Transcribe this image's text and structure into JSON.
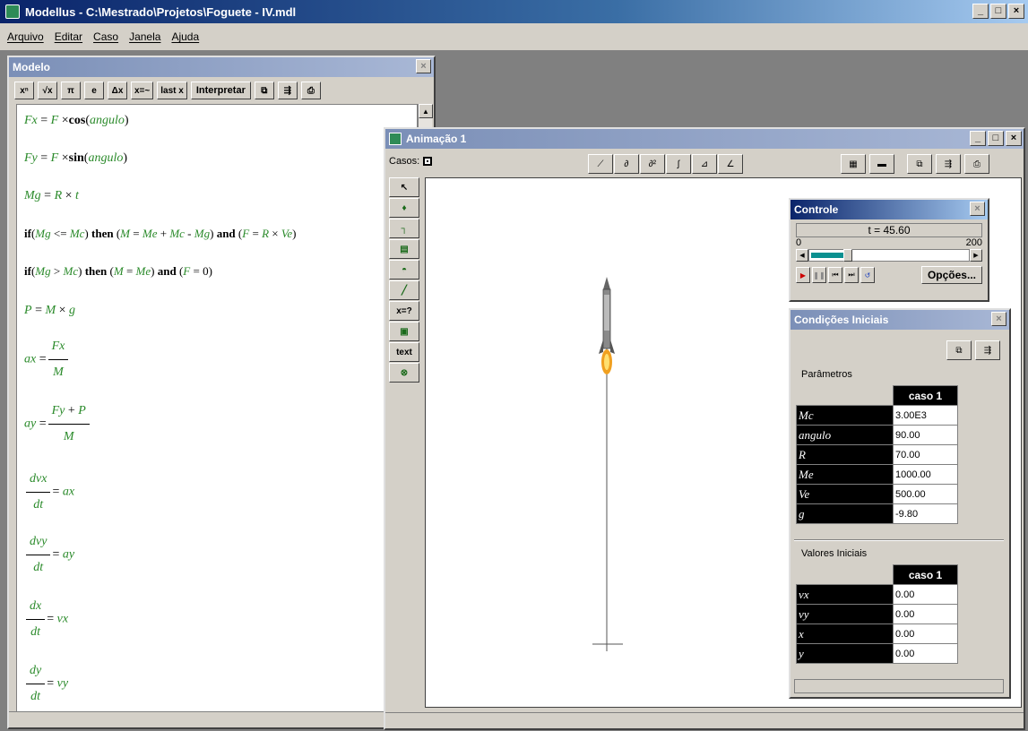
{
  "app": {
    "title": "Modellus - C:\\Mestrado\\Projetos\\Foguete - IV.mdl",
    "menu": [
      "Arquivo",
      "Editar",
      "Caso",
      "Janela",
      "Ajuda"
    ],
    "window_buttons": [
      "_",
      "□",
      "×"
    ]
  },
  "modelo": {
    "title": "Modelo",
    "toolbar": [
      "xⁿ",
      "√x",
      "π",
      "e",
      "Δx",
      "x=~",
      "last x",
      "Interpretar"
    ],
    "equations": {
      "fx": [
        "Fx",
        "F",
        "cos",
        "angulo"
      ],
      "fy": [
        "Fy",
        "F",
        "sin",
        "angulo"
      ],
      "mg": [
        "Mg",
        "R",
        "t"
      ],
      "if1": [
        "if",
        "Mg",
        "Mc",
        "then",
        "M",
        "Me",
        "Mc",
        "Mg",
        "and",
        "F",
        "R",
        "Ve"
      ],
      "if2": [
        "if",
        "Mg",
        "Mc",
        "then",
        "M",
        "Me",
        "and",
        "F",
        "0"
      ],
      "p": [
        "P",
        "M",
        "g"
      ],
      "ax": [
        "ax",
        "Fx",
        "M"
      ],
      "ay": [
        "ay",
        "Fy",
        "P",
        "M"
      ],
      "dvx": [
        "dvx",
        "dt",
        "ax"
      ],
      "dvy": [
        "dvy",
        "dt",
        "ay"
      ],
      "dx": [
        "dx",
        "dt",
        "vx"
      ],
      "dy": [
        "dy",
        "dt",
        "vy"
      ]
    }
  },
  "animacao": {
    "title": "Animação 1",
    "casos_label": "Casos:",
    "left_tools": [
      "↖",
      "♦",
      "┐",
      "▤",
      "◓",
      "╱",
      "x=?",
      "▣",
      "text",
      "⊗"
    ]
  },
  "controle": {
    "title": "Controle",
    "time_label": "t = ",
    "time_value": "45.60",
    "range_min": "0",
    "range_max": "200",
    "progress_fraction": 0.228,
    "options_button": "Opções..."
  },
  "condicoes": {
    "title": "Condições Iniciais",
    "parametros_label": "Parâmetros",
    "valores_label": "Valores Iniciais",
    "caso_header": "caso 1",
    "parametros": [
      {
        "name": "Mc",
        "value": "3.00E3"
      },
      {
        "name": "angulo",
        "value": "90.00"
      },
      {
        "name": "R",
        "value": "70.00"
      },
      {
        "name": "Me",
        "value": "1000.00"
      },
      {
        "name": "Ve",
        "value": "500.00"
      },
      {
        "name": "g",
        "value": "-9.80"
      }
    ],
    "valores": [
      {
        "name": "vx",
        "value": "0.00"
      },
      {
        "name": "vy",
        "value": "0.00"
      },
      {
        "name": "x",
        "value": "0.00"
      },
      {
        "name": "y",
        "value": "0.00"
      }
    ]
  }
}
